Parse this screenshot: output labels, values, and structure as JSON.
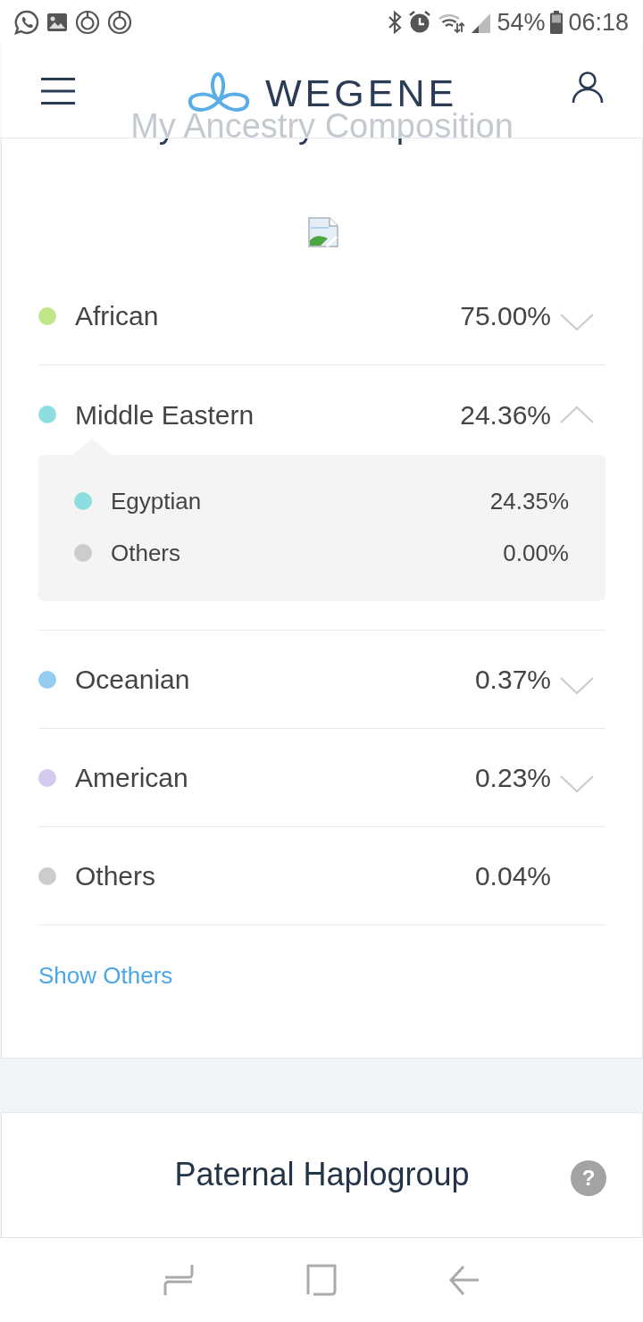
{
  "status_bar": {
    "battery": "54%",
    "time": "06:18"
  },
  "header": {
    "logo_text": "WEGENE"
  },
  "ancestry": {
    "title": "My Ancestry Composition",
    "regions": [
      {
        "kind": "expandable",
        "name": "African",
        "percent": "75.00%",
        "color": "#c0e68a",
        "expanded": false
      },
      {
        "kind": "expandable",
        "name": "Middle Eastern",
        "percent": "24.36%",
        "color": "#8edde0",
        "expanded": true,
        "children": [
          {
            "name": "Egyptian",
            "percent": "24.35%",
            "color": "#8edde0"
          },
          {
            "name": "Others",
            "percent": "0.00%",
            "color": "#cccccc"
          }
        ]
      },
      {
        "kind": "expandable",
        "name": "Oceanian",
        "percent": "0.37%",
        "color": "#95cdf1",
        "expanded": false
      },
      {
        "kind": "expandable",
        "name": "American",
        "percent": "0.23%",
        "color": "#d5c9ed",
        "expanded": false
      },
      {
        "kind": "plain",
        "name": "Others",
        "percent": "0.04%",
        "color": "#cccccc",
        "expanded": false
      }
    ],
    "show_others": "Show Others"
  },
  "paternal_haplogroup": {
    "title": "Paternal Haplogroup",
    "help": "?"
  }
}
